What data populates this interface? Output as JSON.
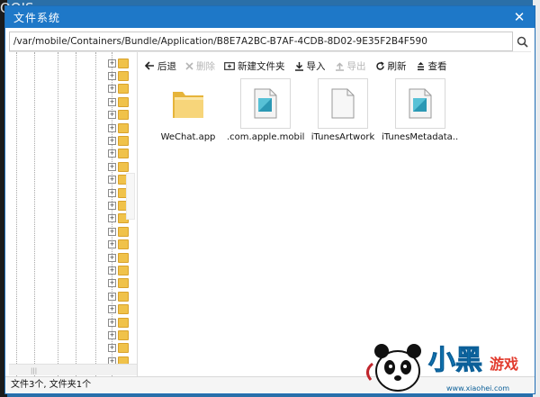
{
  "background": {
    "partial_title": "OOIS"
  },
  "window": {
    "title": "文件系统",
    "close_glyph": "✕"
  },
  "pathbar": {
    "path": "/var/mobile/Containers/Bundle/Application/B8E7A2BC-B7AF-4CDB-8D02-9E35F2B4F590"
  },
  "toolbar": {
    "back": "后退",
    "delete": "删除",
    "new_folder": "新建文件夹",
    "import": "导入",
    "export": "导出",
    "refresh": "刷新",
    "view": "查看"
  },
  "files": [
    {
      "name": "WeChat.app",
      "icon": "folder-icon"
    },
    {
      "name": ".com.apple.mobil...",
      "icon": "document-icon"
    },
    {
      "name": "iTunesArtwork",
      "icon": "blank-file-icon"
    },
    {
      "name": "iTunesMetadata....",
      "icon": "document-icon"
    }
  ],
  "statusbar": {
    "text": "文件3个, 文件夹1个"
  },
  "watermark": {
    "brand": "小黑游戏",
    "url": "www.xiaohei.com"
  },
  "colors": {
    "titlebar": "#1e78c8",
    "folder": "#f0c24a",
    "accent_logo": "#1aa3e8"
  }
}
